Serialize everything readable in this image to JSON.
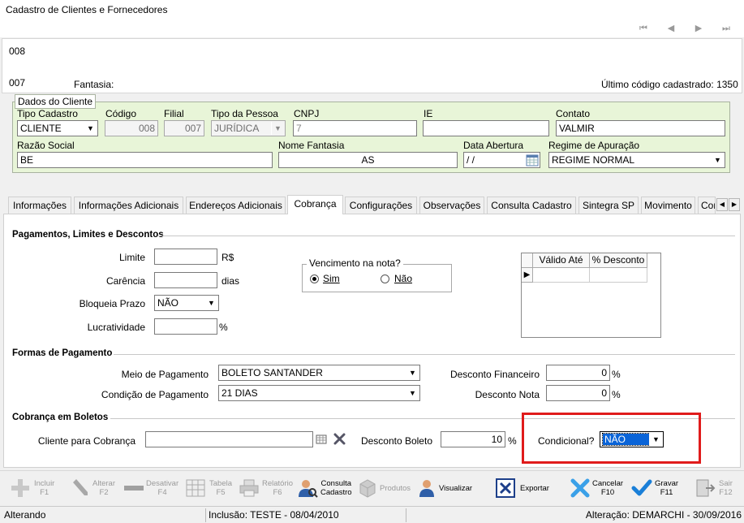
{
  "window": {
    "title": "Cadastro de Clientes e Fornecedores"
  },
  "nav": {
    "first": "⏮",
    "prev": "◀",
    "next": "▶",
    "last": "⏭"
  },
  "header": {
    "code_top": "008",
    "code_bottom": "007",
    "fantasia_label": "Fantasia:",
    "ultimo_codigo": "Último código cadastrado: 1350"
  },
  "dados_cliente": {
    "legend": "Dados do Cliente",
    "tipo_cadastro_label": "Tipo Cadastro",
    "tipo_cadastro": "CLIENTE",
    "codigo_label": "Código",
    "codigo": "008",
    "filial_label": "Filial",
    "filial": "007",
    "tipo_pessoa_label": "Tipo da Pessoa",
    "tipo_pessoa": "JURÍDICA",
    "cnpj_label": "CNPJ",
    "cnpj": "7",
    "ie_label": "IE",
    "ie": "",
    "contato_label": "Contato",
    "contato": "VALMIR",
    "razao_social_label": "Razão Social",
    "razao_social": "BE",
    "nome_fantasia_label": "Nome Fantasia",
    "nome_fantasia": "AS",
    "data_abertura_label": "Data Abertura",
    "data_abertura": " / /",
    "regime_label": "Regime de Apuração",
    "regime": "REGIME NORMAL"
  },
  "tabs": [
    {
      "label": "Informações"
    },
    {
      "label": "Informações Adicionais"
    },
    {
      "label": "Endereços Adicionais"
    },
    {
      "label": "Cobrança"
    },
    {
      "label": "Configurações"
    },
    {
      "label": "Observações"
    },
    {
      "label": "Consulta Cadastro"
    },
    {
      "label": "Sintegra SP"
    },
    {
      "label": "Movimento"
    },
    {
      "label": "Cor"
    }
  ],
  "cobranca": {
    "pagamentos_title": "Pagamentos, Limites e Descontos",
    "limite_label": "Limite",
    "limite": "",
    "limite_unit": "R$",
    "carencia_label": "Carência",
    "carencia": "",
    "carencia_unit": "dias",
    "bloqueia_label": "Bloqueia Prazo",
    "bloqueia": "NÃO",
    "lucratividade_label": "Lucratividade",
    "lucratividade": "",
    "lucratividade_unit": "%",
    "vencimento_title": "Vencimento na nota?",
    "vencimento_sim": "Sim",
    "vencimento_nao": "Não",
    "grid_col1": "Válido Até",
    "grid_col2": "% Desconto",
    "formas_title": "Formas de Pagamento",
    "meio_label": "Meio de Pagamento",
    "meio": "BOLETO SANTANDER",
    "condicao_label": "Condição de Pagamento",
    "condicao": "21 DIAS",
    "desc_fin_label": "Desconto Financeiro",
    "desc_fin": "0",
    "desc_fin_unit": "%",
    "desc_nota_label": "Desconto Nota",
    "desc_nota": "0",
    "desc_nota_unit": "%",
    "boletos_title": "Cobrança em Boletos",
    "cliente_cobranca_label": "Cliente para Cobrança",
    "cliente_cobranca": "",
    "desc_boleto_label": "Desconto Boleto",
    "desc_boleto": "10",
    "desc_boleto_unit": "%",
    "condicional_label": "Condicional?",
    "condicional": "NÃO"
  },
  "toolbar": {
    "incluir": "Incluir",
    "incluir_key": "F1",
    "alterar": "Alterar",
    "alterar_key": "F2",
    "desativar": "Desativar",
    "desativar_key": "F4",
    "tabela": "Tabela",
    "tabela_key": "F5",
    "relatorio": "Relatório",
    "relatorio_key": "F6",
    "consulta": "Consulta",
    "consulta2": "Cadastro",
    "produtos": "Produtos",
    "visualizar": "Visualizar",
    "exportar": "Exportar",
    "cancelar": "Cancelar",
    "cancelar_key": "F10",
    "gravar": "Gravar",
    "gravar_key": "F11",
    "sair": "Sair",
    "sair_key": "F12"
  },
  "status": {
    "mode": "Alterando",
    "inclusao": "Inclusão: TESTE - 08/04/2010",
    "alteracao": "Alteração: DEMARCHI - 30/09/2016"
  }
}
